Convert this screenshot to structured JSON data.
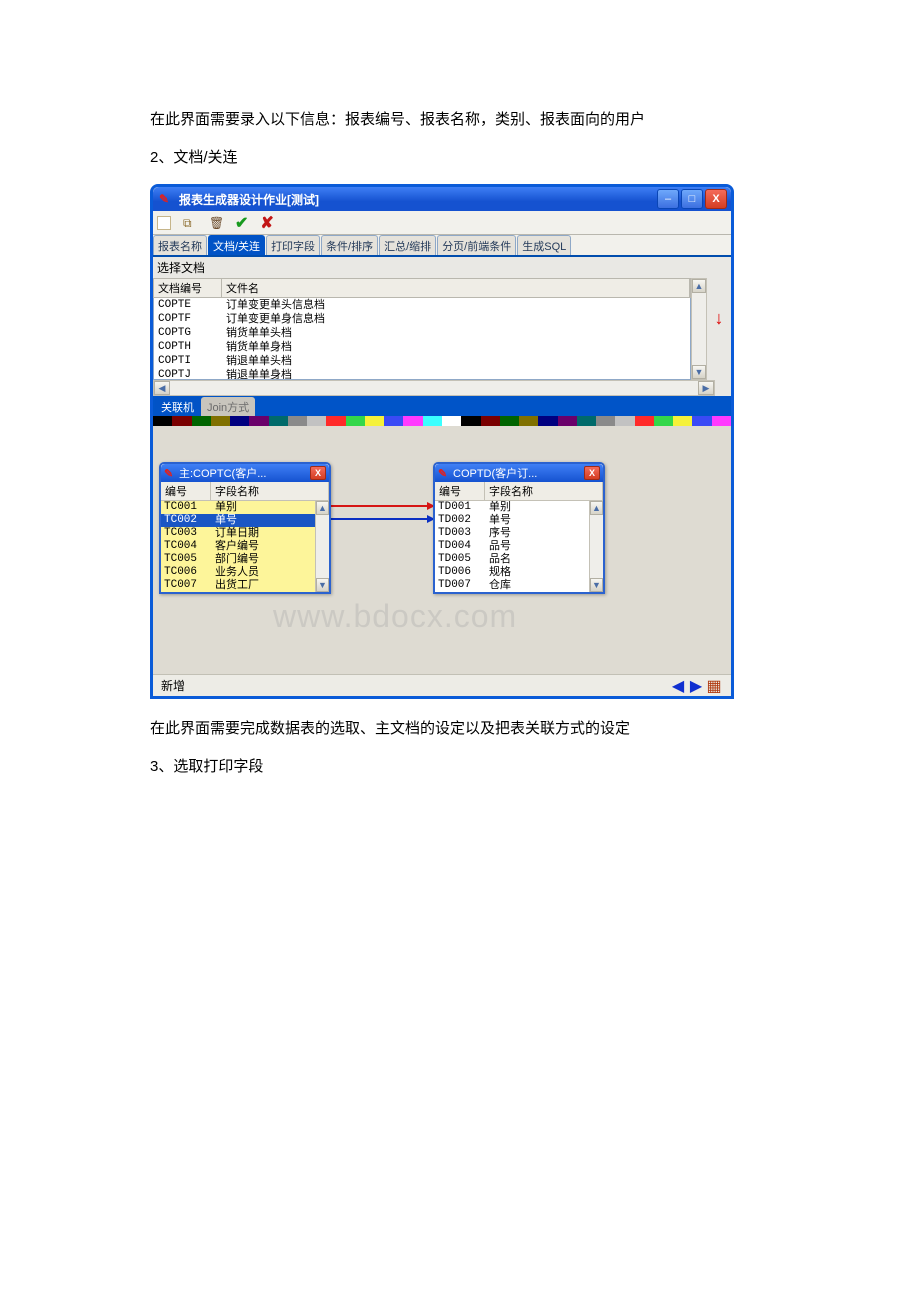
{
  "doc": {
    "p1": "在此界面需要录入以下信息：报表编号、报表名称，类别、报表面向的用户",
    "p2": "2、文档/关连",
    "p3": "在此界面需要完成数据表的选取、主文档的设定以及把表关联方式的设定",
    "p4": "3、选取打印字段"
  },
  "window": {
    "title": "报表生成器设计作业[测试]"
  },
  "tabs": {
    "t1": "报表名称",
    "t2": "文档/关连",
    "t3": "打印字段",
    "t4": "条件/排序",
    "t5": "汇总/缩排",
    "t6": "分页/前端条件",
    "t7": "生成SQL"
  },
  "file_select": {
    "label": "选择文档",
    "col1": "文档编号",
    "col2": "文件名",
    "rows": [
      {
        "id": "COPTE",
        "name": "订单变更单头信息档"
      },
      {
        "id": "COPTF",
        "name": "订单变更单身信息档"
      },
      {
        "id": "COPTG",
        "name": "销货单单头档"
      },
      {
        "id": "COPTH",
        "name": "销货单单身档"
      },
      {
        "id": "COPTI",
        "name": "销退单单头档"
      },
      {
        "id": "COPTJ",
        "name": "销退单单身档"
      }
    ]
  },
  "subtabs": {
    "a": "关联机",
    "b": "Join方式"
  },
  "colors": [
    "#000000",
    "#7a0000",
    "#006400",
    "#807000",
    "#000080",
    "#6a006a",
    "#006a6a",
    "#8a8a8a",
    "#c2c2c2",
    "#ff2a2a",
    "#33d74a",
    "#f5f13a",
    "#3a4af5",
    "#ff3aff",
    "#3affff",
    "#ffffff",
    "#000000",
    "#7a0000",
    "#006400",
    "#807000",
    "#000080",
    "#6a006a",
    "#006a6a",
    "#8a8a8a",
    "#c2c2c2",
    "#ff2a2a",
    "#33d74a",
    "#f5f13a",
    "#3a4af5",
    "#ff3aff"
  ],
  "master": {
    "title": "主:COPTC(客户...",
    "h1": "编号",
    "h2": "字段名称",
    "rows": [
      {
        "id": "TC001",
        "name": "单别"
      },
      {
        "id": "TC002",
        "name": "单号"
      },
      {
        "id": "TC003",
        "name": "订单日期"
      },
      {
        "id": "TC004",
        "name": "客户编号"
      },
      {
        "id": "TC005",
        "name": "部门编号"
      },
      {
        "id": "TC006",
        "name": "业务人员"
      },
      {
        "id": "TC007",
        "name": "出货工厂"
      }
    ]
  },
  "detail": {
    "title": "COPTD(客户订...",
    "h1": "编号",
    "h2": "字段名称",
    "rows": [
      {
        "id": "TD001",
        "name": "单别"
      },
      {
        "id": "TD002",
        "name": "单号"
      },
      {
        "id": "TD003",
        "name": "序号"
      },
      {
        "id": "TD004",
        "name": "品号"
      },
      {
        "id": "TD005",
        "name": "品名"
      },
      {
        "id": "TD006",
        "name": "规格"
      },
      {
        "id": "TD007",
        "name": "仓库"
      }
    ]
  },
  "status": {
    "text": "新增"
  },
  "wm": "www.bdocx.com"
}
